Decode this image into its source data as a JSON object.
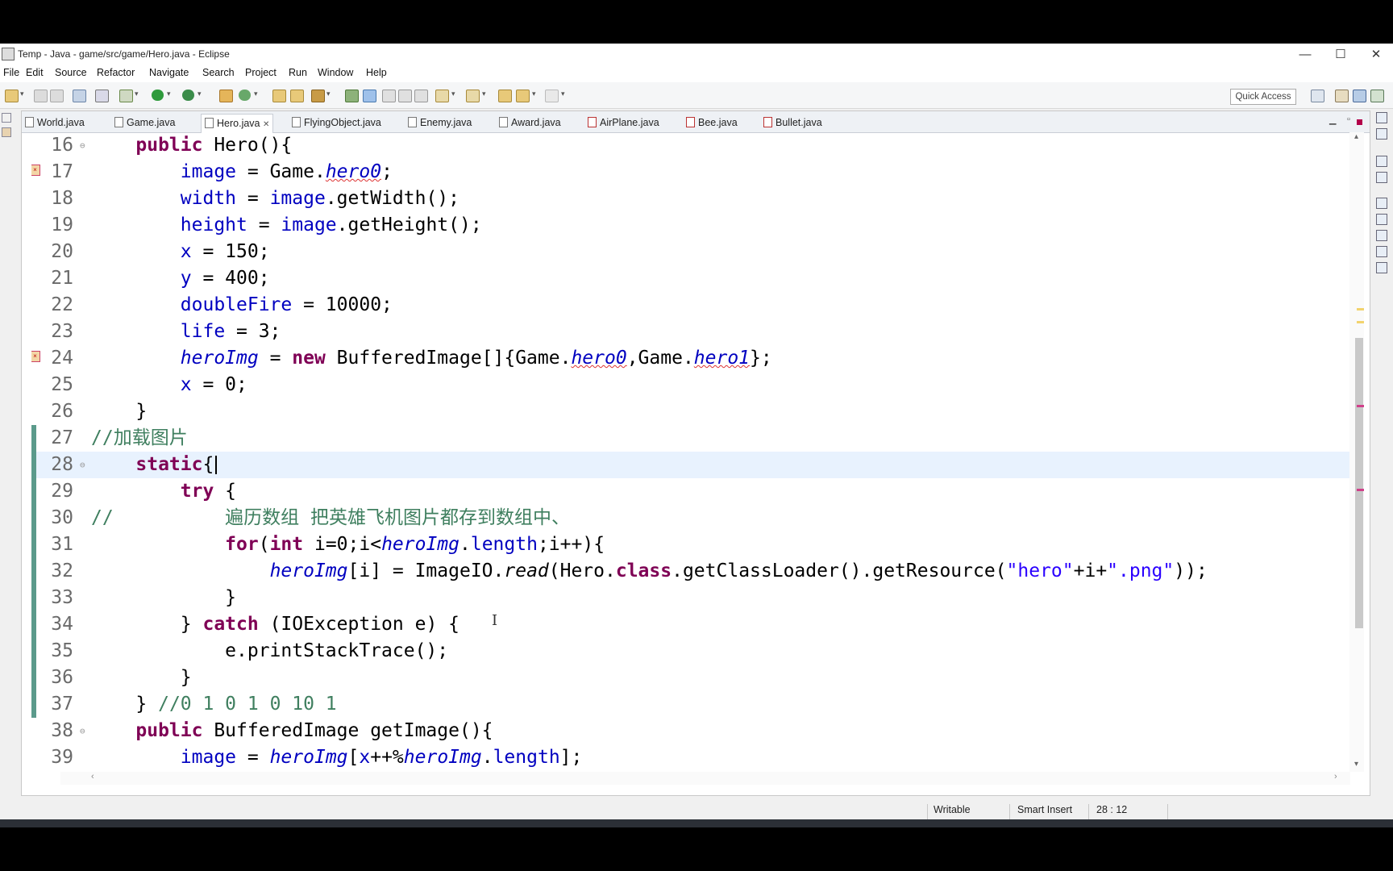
{
  "window": {
    "title": "Temp - Java - game/src/game/Hero.java - Eclipse",
    "minimize": "—",
    "maximize": "☐",
    "close": "✕"
  },
  "menu": [
    "File",
    "Edit",
    "Source",
    "Refactor",
    "Navigate",
    "Search",
    "Project",
    "Run",
    "Window",
    "Help"
  ],
  "toolbar": {
    "quick_access": "Quick Access"
  },
  "tabs": [
    {
      "label": "World.java",
      "active": false,
      "error": false
    },
    {
      "label": "Game.java",
      "active": false,
      "error": false
    },
    {
      "label": "Hero.java",
      "active": true,
      "error": false
    },
    {
      "label": "FlyingObject.java",
      "active": false,
      "error": false
    },
    {
      "label": "Enemy.java",
      "active": false,
      "error": false
    },
    {
      "label": "Award.java",
      "active": false,
      "error": false
    },
    {
      "label": "AirPlane.java",
      "active": false,
      "error": true
    },
    {
      "label": "Bee.java",
      "active": false,
      "error": true
    },
    {
      "label": "Bullet.java",
      "active": false,
      "error": true
    }
  ],
  "tab_close_glyph": "✕",
  "editor": {
    "cursor_line": 28,
    "lines": [
      {
        "n": "16",
        "html": "    <span class=\"kw\">public</span> Hero(){",
        "fold": true
      },
      {
        "n": "17",
        "html": "        <span class=\"fld\">image</span> = Game.<span class=\"sfld wavy\">hero0</span>;",
        "err": true
      },
      {
        "n": "18",
        "html": "        <span class=\"fld\">width</span> = <span class=\"fld\">image</span>.getWidth();"
      },
      {
        "n": "19",
        "html": "        <span class=\"fld\">height</span> = <span class=\"fld\">image</span>.getHeight();"
      },
      {
        "n": "20",
        "html": "        <span class=\"fld\">x</span> = 150;"
      },
      {
        "n": "21",
        "html": "        <span class=\"fld\">y</span> = 400;"
      },
      {
        "n": "22",
        "html": "        <span class=\"fld\">doubleFire</span> = 10000;"
      },
      {
        "n": "23",
        "html": "        <span class=\"fld\">life</span> = 3;"
      },
      {
        "n": "24",
        "html": "        <span class=\"sfld\">heroImg</span> = <span class=\"kw\">new</span> BufferedImage[]{Game.<span class=\"sfld wavy\">hero0</span>,Game.<span class=\"sfld wavy\">hero1</span>};",
        "err": true
      },
      {
        "n": "25",
        "html": "        <span class=\"fld\">x</span> = 0;"
      },
      {
        "n": "26",
        "html": "    }"
      },
      {
        "n": "27",
        "html": "<span class=\"cm\">//加载图片</span>",
        "marker": true
      },
      {
        "n": "28",
        "html": "    <span class=\"kw\">static</span>{",
        "marker": true,
        "fold": true,
        "cur": true
      },
      {
        "n": "29",
        "html": "        <span class=\"kw\">try</span> {",
        "marker": true
      },
      {
        "n": "30",
        "html": "<span class=\"cm\">//          遍历数组 把英雄飞机图片都存到数组中、</span>",
        "marker": true
      },
      {
        "n": "31",
        "html": "            <span class=\"kw\">for</span>(<span class=\"kw\">int</span> i=0;i&lt;<span class=\"sfld\">heroImg</span>.<span class=\"fld\">length</span>;i++){",
        "marker": true
      },
      {
        "n": "32",
        "html": "                <span class=\"sfld\">heroImg</span>[i] = ImageIO.<span class=\"it\">read</span>(Hero.<span class=\"kw\">class</span>.getClassLoader().getResource(<span class=\"str\">\"hero\"</span>+i+<span class=\"str\">\".png\"</span>));",
        "marker": true
      },
      {
        "n": "33",
        "html": "            }",
        "marker": true
      },
      {
        "n": "34",
        "html": "        } <span class=\"kw\">catch</span> (IOException e) {",
        "marker": true
      },
      {
        "n": "35",
        "html": "            e.printStackTrace();",
        "marker": true
      },
      {
        "n": "36",
        "html": "        }",
        "marker": true
      },
      {
        "n": "37",
        "html": "    } <span class=\"cm\">//0 1 0 1 0 10 1</span>",
        "marker": true
      },
      {
        "n": "38",
        "html": "    <span class=\"kw\">public</span> BufferedImage getImage(){",
        "fold": true
      },
      {
        "n": "39",
        "html": "        <span class=\"fld\">image</span> = <span class=\"sfld\">heroImg</span>[<span class=\"fld\">x</span>++%<span class=\"sfld\">heroImg</span>.<span class=\"fld\">length</span>];"
      }
    ]
  },
  "status": {
    "writable": "Writable",
    "insert_mode": "Smart Insert",
    "position": "28 : 12"
  },
  "colors": {
    "keyword": "#7f0055",
    "field": "#0000c0",
    "comment": "#3f7f5f",
    "string": "#2a00ff",
    "current_line": "#e8f2fe"
  }
}
